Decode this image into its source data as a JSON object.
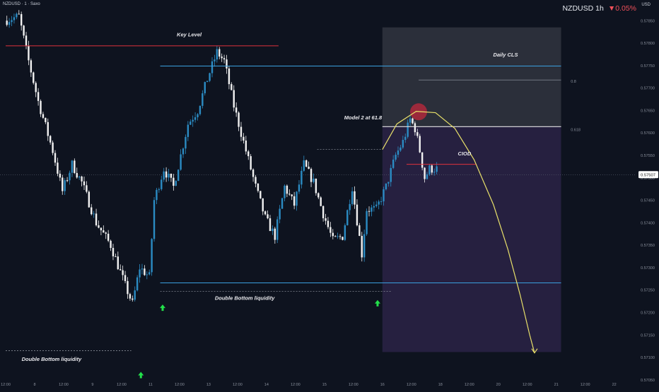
{
  "header": {
    "symbol_line": "NZDUSD · 1 · Saxo",
    "ticker": "NZDUSD 1h",
    "change": "▼0.05%",
    "currency": "USD"
  },
  "colors": {
    "background": "#0e131f",
    "candle_up": "#2b8cc4",
    "candle_down": "#f2f2f2",
    "key_level": "#e0323c",
    "level_line": "#3aa0e0",
    "projection": "#e8e06a",
    "arrow": "#22e04a",
    "premium_zone": "#303540",
    "discount_zone": "#2a2347",
    "model_marker": "#c2283c",
    "price_tag": "#ffffff"
  },
  "chart_data": {
    "type": "candlestick",
    "title": "NZDUSD 1h",
    "xlabel": "",
    "ylabel": "",
    "ylim": [
      0.57045,
      0.57885
    ],
    "y_ticks": [
      0.5705,
      0.571,
      0.5715,
      0.572,
      0.5725,
      0.573,
      0.5735,
      0.574,
      0.5745,
      0.575,
      0.5755,
      0.576,
      0.5765,
      0.577,
      0.5775,
      0.578,
      0.5785
    ],
    "y_tick_labels": [
      "0.57050",
      "0.57100",
      "0.57150",
      "0.57200",
      "0.57250",
      "0.57300",
      "0.57350",
      "0.57400",
      "0.57450",
      "0.57500",
      "0.57550",
      "0.57600",
      "0.57650",
      "0.57700",
      "0.57750",
      "0.57800",
      "0.57850"
    ],
    "x_ticks": [
      {
        "t": 0,
        "label": "12:00"
      },
      {
        "t": 12,
        "label": "8"
      },
      {
        "t": 24,
        "label": "12:00"
      },
      {
        "t": 36,
        "label": "9"
      },
      {
        "t": 48,
        "label": "12:00"
      },
      {
        "t": 60,
        "label": "11"
      },
      {
        "t": 72,
        "label": "12:00"
      },
      {
        "t": 84,
        "label": "13"
      },
      {
        "t": 96,
        "label": "12:00"
      },
      {
        "t": 108,
        "label": "14"
      },
      {
        "t": 120,
        "label": "12:00"
      },
      {
        "t": 132,
        "label": "15"
      },
      {
        "t": 144,
        "label": "12:00"
      },
      {
        "t": 156,
        "label": "16"
      },
      {
        "t": 168,
        "label": "12:00"
      },
      {
        "t": 180,
        "label": "18"
      },
      {
        "t": 192,
        "label": "12:00"
      },
      {
        "t": 204,
        "label": "20"
      },
      {
        "t": 216,
        "label": "12:00"
      },
      {
        "t": 228,
        "label": "21"
      },
      {
        "t": 240,
        "label": "12:00"
      },
      {
        "t": 252,
        "label": "22"
      }
    ],
    "current_price": 0.57507,
    "current_price_label": "0.57507",
    "series_anchors": [
      [
        0,
        0.5785
      ],
      [
        6,
        0.5786
      ],
      [
        10,
        0.5776
      ],
      [
        14,
        0.5767
      ],
      [
        20,
        0.5756
      ],
      [
        24,
        0.5747
      ],
      [
        28,
        0.5753
      ],
      [
        32,
        0.5749
      ],
      [
        38,
        0.574
      ],
      [
        44,
        0.5735
      ],
      [
        50,
        0.5726
      ],
      [
        53,
        0.5722
      ],
      [
        56,
        0.573
      ],
      [
        60,
        0.5728
      ],
      [
        62,
        0.5745
      ],
      [
        66,
        0.5752
      ],
      [
        70,
        0.5748
      ],
      [
        76,
        0.5762
      ],
      [
        80,
        0.5765
      ],
      [
        84,
        0.5772
      ],
      [
        88,
        0.5778
      ],
      [
        91,
        0.5776
      ],
      [
        95,
        0.5766
      ],
      [
        100,
        0.5756
      ],
      [
        104,
        0.5748
      ],
      [
        108,
        0.5741
      ],
      [
        112,
        0.5737
      ],
      [
        116,
        0.5748
      ],
      [
        120,
        0.5744
      ],
      [
        124,
        0.5753
      ],
      [
        128,
        0.5749
      ],
      [
        132,
        0.5742
      ],
      [
        136,
        0.5736
      ],
      [
        140,
        0.5737
      ],
      [
        144,
        0.5748
      ],
      [
        148,
        0.5733
      ],
      [
        150,
        0.5743
      ],
      [
        154,
        0.5743
      ],
      [
        158,
        0.5748
      ],
      [
        162,
        0.5755
      ],
      [
        165,
        0.5758
      ],
      [
        168,
        0.5763
      ],
      [
        170,
        0.5761
      ],
      [
        172,
        0.5756
      ],
      [
        174,
        0.575
      ],
      [
        176,
        0.5752
      ],
      [
        178,
        0.5752
      ]
    ],
    "zones": [
      {
        "name": "premium",
        "t0": 156,
        "t1": 230,
        "y_top": 0.57835,
        "y_bottom": 0.57615
      },
      {
        "name": "discount",
        "t0": 156,
        "t1": 230,
        "y_top": 0.57615,
        "y_bottom": 0.57112
      }
    ],
    "levels": [
      {
        "name": "key-level",
        "t0": 0,
        "t1": 113,
        "y": 0.57794,
        "style": "red"
      },
      {
        "name": "daily-cls",
        "t0": 64,
        "t1": 230,
        "y": 0.57749,
        "style": "blue"
      },
      {
        "name": "double-bottom-upper",
        "t0": 64,
        "t1": 230,
        "y": 0.57266,
        "style": "blue"
      },
      {
        "name": "fib-0.8",
        "t0": 171,
        "t1": 230,
        "y": 0.57718,
        "style": "gray"
      },
      {
        "name": "fib-0.618",
        "t0": 156,
        "t1": 230,
        "y": 0.57614,
        "style": "white"
      },
      {
        "name": "ciod-line",
        "t0": 166,
        "t1": 195,
        "y": 0.5753,
        "style": "red"
      },
      {
        "name": "dotted-high",
        "t0": 129,
        "t1": 156,
        "y": 0.57563,
        "style": "dotted"
      },
      {
        "name": "dotted-low-right",
        "t0": 64,
        "t1": 160,
        "y": 0.57247,
        "style": "dotted"
      },
      {
        "name": "dotted-low-left",
        "t0": 0,
        "t1": 52,
        "y": 0.57115,
        "style": "dotted"
      }
    ],
    "annotations": [
      {
        "text": "Key Level",
        "t": 76,
        "y": 0.57815
      },
      {
        "text": "Daily CLS",
        "t": 207,
        "y": 0.5777
      },
      {
        "text": "Model 2  at 61.8",
        "t": 148,
        "y": 0.5763
      },
      {
        "text": "CIOD",
        "t": 190,
        "y": 0.5755
      },
      {
        "text": "Double Bottom liquidity",
        "t": 99,
        "y": 0.57228
      },
      {
        "text": "Double Bottom liquidity",
        "t": 19,
        "y": 0.57092
      },
      {
        "text": "0.8",
        "t": 234,
        "y": 0.57712
      },
      {
        "text": "0.618",
        "t": 234,
        "y": 0.57604
      }
    ],
    "arrows": [
      {
        "t": 65,
        "y": 0.5721
      },
      {
        "t": 154,
        "y": 0.5722
      },
      {
        "t": 56,
        "y": 0.5706
      }
    ],
    "projection_path": [
      [
        156,
        0.57563
      ],
      [
        162,
        0.5762
      ],
      [
        170,
        0.57648
      ],
      [
        178,
        0.57645
      ],
      [
        186,
        0.5761
      ],
      [
        194,
        0.5754
      ],
      [
        202,
        0.5744
      ],
      [
        208,
        0.5734
      ],
      [
        213,
        0.5724
      ],
      [
        217,
        0.5715
      ],
      [
        219,
        0.5711
      ]
    ],
    "model_marker": {
      "t": 171,
      "y": 0.57647
    }
  }
}
